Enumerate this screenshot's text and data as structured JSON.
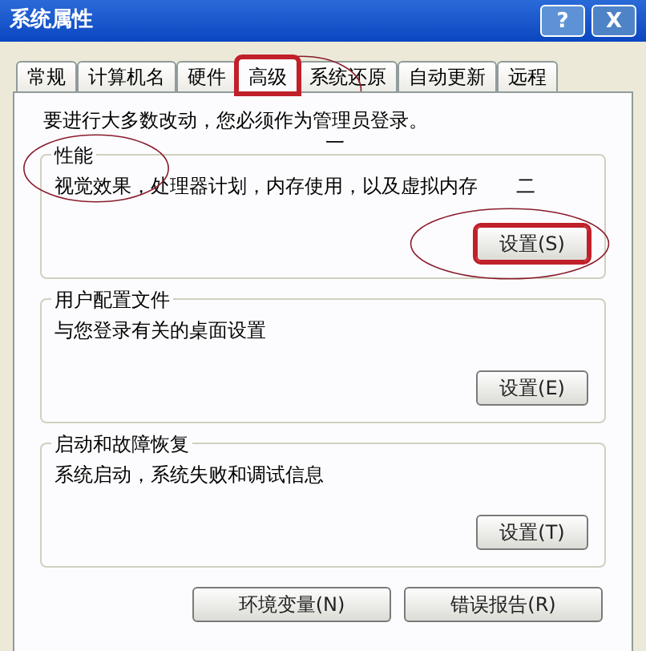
{
  "window": {
    "title": "系统属性",
    "buttons": [
      {
        "kind": "help",
        "label": "?"
      },
      {
        "kind": "close",
        "label": "X"
      }
    ]
  },
  "tabs": [
    {
      "label": "常规",
      "selected": false,
      "boxed": false
    },
    {
      "label": "计算机名",
      "selected": false,
      "boxed": false
    },
    {
      "label": "硬件",
      "selected": false,
      "boxed": false
    },
    {
      "label": "高级",
      "selected": true,
      "boxed": true
    },
    {
      "label": "系统还原",
      "selected": false,
      "boxed": false
    },
    {
      "label": "自动更新",
      "selected": false,
      "boxed": false
    },
    {
      "label": "远程",
      "selected": false,
      "boxed": false
    }
  ],
  "notice": "要进行大多数改动，您必须作为管理员登录。",
  "notice_mark": "一",
  "groups": [
    {
      "title": "性能",
      "title_circled": true,
      "description": "视觉效果，处理器计划，内存使用，以及虚拟内存",
      "mark": "二",
      "button": {
        "label": "设置(S)",
        "boxed": true
      }
    },
    {
      "title": "用户配置文件",
      "title_circled": false,
      "description": "与您登录有关的桌面设置",
      "button": {
        "label": "设置(E)",
        "boxed": false
      }
    },
    {
      "title": "启动和故障恢复",
      "title_circled": false,
      "description": "系统启动，系统失败和调试信息",
      "button": {
        "label": "设置(T)",
        "boxed": false
      }
    }
  ],
  "bottom_buttons": [
    "环境变量(N)",
    "错误报告(R)"
  ]
}
